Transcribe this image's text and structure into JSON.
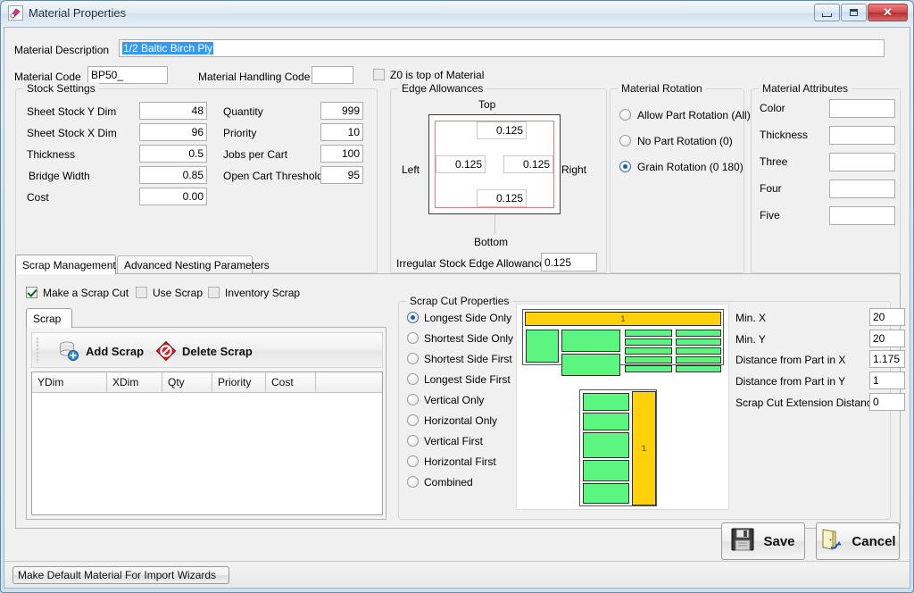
{
  "window": {
    "title": "Material Properties",
    "icon": "material-properties-icon",
    "controls": {
      "minimize": "minimize-button",
      "maximize": "maximize-button",
      "close": "close-button",
      "close_glyph": "✕"
    }
  },
  "header": {
    "material_description_label": "Material Description",
    "material_description_value": "1/2 Baltic Birch Ply",
    "material_code_label": "Material Code",
    "material_code_value": "BP50_",
    "material_handling_code_label": "Material Handling Code",
    "material_handling_code_value": "",
    "z0_label": "Z0 is top of Material",
    "z0_checked": false
  },
  "stock_settings": {
    "title": "Stock Settings",
    "left_fields": [
      {
        "label": "Sheet Stock Y Dim",
        "value": "48"
      },
      {
        "label": "Sheet Stock X Dim",
        "value": "96"
      },
      {
        "label": "Thickness",
        "value": "0.5"
      },
      {
        "label": "Bridge Width",
        "value": "0.85"
      },
      {
        "label": "Cost",
        "value": "0.00"
      }
    ],
    "right_fields": [
      {
        "label": "Quantity",
        "value": "999"
      },
      {
        "label": "Priority",
        "value": "10"
      },
      {
        "label": "Jobs per Cart",
        "value": "100"
      },
      {
        "label": "Open Cart Threshold",
        "value": "95"
      }
    ]
  },
  "edge_allowances": {
    "title": "Edge Allowances",
    "top_label": "Top",
    "bottom_label": "Bottom",
    "left_label": "Left",
    "right_label": "Right",
    "top_value": "0.125",
    "bottom_value": "0.125",
    "left_value": "0.125",
    "right_value": "0.125",
    "irregular_label": "Irregular Stock Edge Allowance",
    "irregular_value": "0.125"
  },
  "material_rotation": {
    "title": "Material Rotation",
    "options": [
      {
        "label": "Allow Part Rotation (All)",
        "selected": false
      },
      {
        "label": "No Part Rotation (0)",
        "selected": false
      },
      {
        "label": "Grain Rotation (0 180)",
        "selected": true
      }
    ]
  },
  "material_attributes": {
    "title": "Material Attributes",
    "fields": [
      {
        "label": "Color",
        "value": ""
      },
      {
        "label": "Thickness",
        "value": ""
      },
      {
        "label": "Three",
        "value": ""
      },
      {
        "label": "Four",
        "value": ""
      },
      {
        "label": "Five",
        "value": ""
      }
    ]
  },
  "tabs": [
    {
      "label": "Scrap Management",
      "active": true
    },
    {
      "label": "Advanced Nesting Parameters",
      "active": false
    }
  ],
  "scrap_management": {
    "checkboxes": [
      {
        "label": "Make a Scrap Cut",
        "checked": true
      },
      {
        "label": "Use Scrap",
        "checked": false
      },
      {
        "label": "Inventory Scrap",
        "checked": false
      }
    ],
    "inner_tab": "Scrap",
    "toolbar": [
      {
        "label": "Add Scrap",
        "icon": "add-scrap-icon"
      },
      {
        "label": "Delete Scrap",
        "icon": "delete-scrap-icon"
      }
    ],
    "grid_columns": [
      "YDim",
      "XDim",
      "Qty",
      "Priority",
      "Cost"
    ],
    "grid_rows": []
  },
  "scrap_cut_properties": {
    "title": "Scrap Cut Properties",
    "options": [
      {
        "label": "Longest Side Only",
        "selected": true
      },
      {
        "label": "Shortest Side Only",
        "selected": false
      },
      {
        "label": "Shortest Side First",
        "selected": false
      },
      {
        "label": "Longest Side First",
        "selected": false
      },
      {
        "label": "Vertical Only",
        "selected": false
      },
      {
        "label": "Horizontal Only",
        "selected": false
      },
      {
        "label": "Vertical First",
        "selected": false
      },
      {
        "label": "Horizontal First",
        "selected": false
      },
      {
        "label": "Combined",
        "selected": false
      }
    ],
    "fields": [
      {
        "label": "Min. X",
        "value": "20"
      },
      {
        "label": "Min. Y",
        "value": "20"
      },
      {
        "label": "Distance from Part in X",
        "value": "1.175"
      },
      {
        "label": "Distance from Part in Y",
        "value": "1"
      },
      {
        "label": "Scrap Cut Extension Distance",
        "value": "0"
      }
    ],
    "preview": {
      "scrap_color": "#ffd10a",
      "part_color": "#5cf57f",
      "scrap_label": "1"
    }
  },
  "footer": {
    "save_label": "Save",
    "cancel_label": "Cancel",
    "default_material_label": "Make Default Material For Import Wizards"
  }
}
